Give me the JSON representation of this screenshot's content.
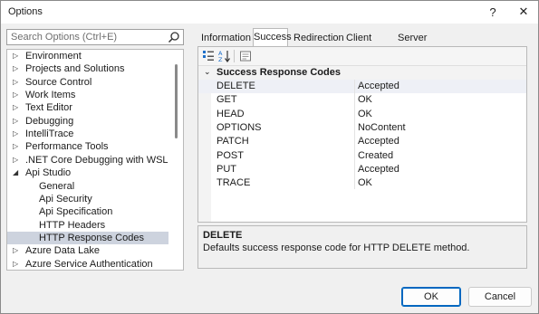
{
  "window": {
    "title": "Options",
    "help": "?",
    "close": "✕"
  },
  "search": {
    "placeholder": "Search Options (Ctrl+E)",
    "value": ""
  },
  "tree": {
    "items": [
      {
        "label": "Environment",
        "arrow": "▷",
        "level": 0,
        "selected": false
      },
      {
        "label": "Projects and Solutions",
        "arrow": "▷",
        "level": 0,
        "selected": false
      },
      {
        "label": "Source Control",
        "arrow": "▷",
        "level": 0,
        "selected": false
      },
      {
        "label": "Work Items",
        "arrow": "▷",
        "level": 0,
        "selected": false
      },
      {
        "label": "Text Editor",
        "arrow": "▷",
        "level": 0,
        "selected": false
      },
      {
        "label": "Debugging",
        "arrow": "▷",
        "level": 0,
        "selected": false
      },
      {
        "label": "IntelliTrace",
        "arrow": "▷",
        "level": 0,
        "selected": false
      },
      {
        "label": "Performance Tools",
        "arrow": "▷",
        "level": 0,
        "selected": false
      },
      {
        "label": ".NET Core Debugging with WSL",
        "arrow": "▷",
        "level": 0,
        "selected": false
      },
      {
        "label": "Api Studio",
        "arrow": "◢",
        "level": 0,
        "selected": false
      },
      {
        "label": "General",
        "arrow": "",
        "level": 1,
        "selected": false
      },
      {
        "label": "Api Security",
        "arrow": "",
        "level": 1,
        "selected": false
      },
      {
        "label": "Api Specification",
        "arrow": "",
        "level": 1,
        "selected": false
      },
      {
        "label": "HTTP Headers",
        "arrow": "",
        "level": 1,
        "selected": false
      },
      {
        "label": "HTTP Response Codes",
        "arrow": "",
        "level": 1,
        "selected": true
      },
      {
        "label": "Azure Data Lake",
        "arrow": "▷",
        "level": 0,
        "selected": false
      },
      {
        "label": "Azure Service Authentication",
        "arrow": "▷",
        "level": 0,
        "selected": false
      }
    ]
  },
  "tabs": [
    {
      "label": "Information",
      "active": false
    },
    {
      "label": "Success",
      "active": true
    },
    {
      "label": "Redirection",
      "active": false
    },
    {
      "label": "Client Error",
      "active": false
    },
    {
      "label": "Server Error",
      "active": false
    }
  ],
  "grid": {
    "category": "Success Response Codes",
    "category_arrow": "⌄",
    "rows": [
      {
        "name": "DELETE",
        "value": "Accepted",
        "selected": true
      },
      {
        "name": "GET",
        "value": "OK",
        "selected": false
      },
      {
        "name": "HEAD",
        "value": "OK",
        "selected": false
      },
      {
        "name": "OPTIONS",
        "value": "NoContent",
        "selected": false
      },
      {
        "name": "PATCH",
        "value": "Accepted",
        "selected": false
      },
      {
        "name": "POST",
        "value": "Created",
        "selected": false
      },
      {
        "name": "PUT",
        "value": "Accepted",
        "selected": false
      },
      {
        "name": "TRACE",
        "value": "OK",
        "selected": false
      }
    ]
  },
  "description": {
    "title": "DELETE",
    "text": "Defaults success response code for HTTP DELETE method."
  },
  "buttons": {
    "ok": "OK",
    "cancel": "Cancel"
  },
  "colors": {
    "accent": "#0067c0",
    "selection": "#cdd3de"
  }
}
